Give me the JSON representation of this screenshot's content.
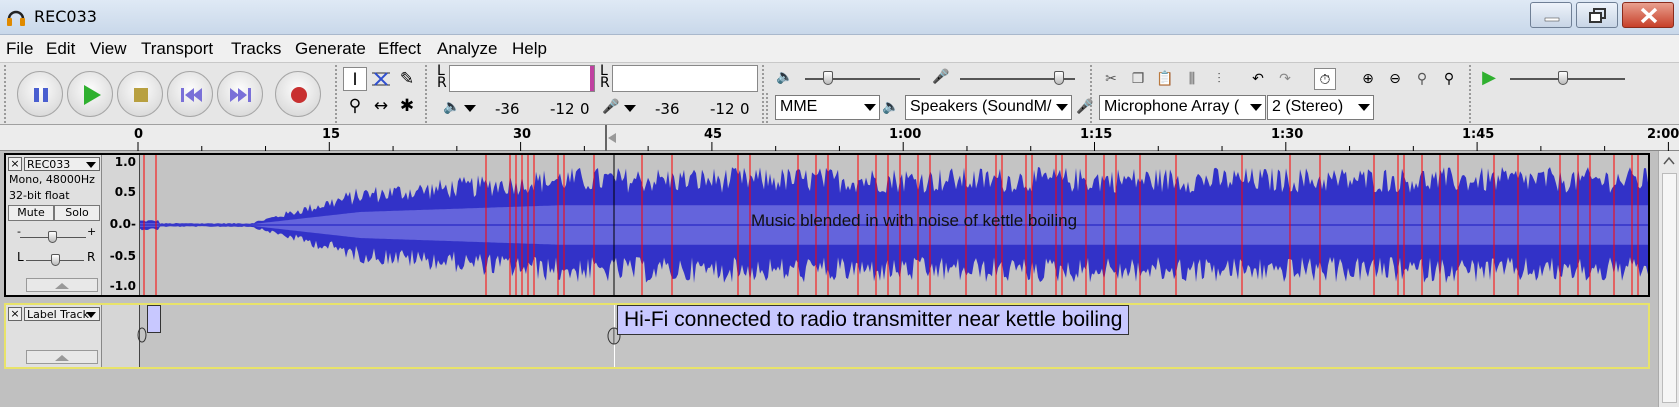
{
  "window": {
    "title": "REC033"
  },
  "menu": [
    "File",
    "Edit",
    "View",
    "Transport",
    "Tracks",
    "Generate",
    "Effect",
    "Analyze",
    "Help"
  ],
  "meters": {
    "play_ticks": [
      "-36",
      "-12",
      "0"
    ],
    "rec_ticks": [
      "-36",
      "-12",
      "0"
    ],
    "lr": [
      "L",
      "R"
    ]
  },
  "device": {
    "host": "MME",
    "output": "Speakers (SoundM/",
    "input": "Microphone Array (",
    "channels": "2 (Stereo)"
  },
  "ruler": {
    "ticks": [
      "0",
      "15",
      "30",
      "45",
      "1:00",
      "1:15",
      "1:30",
      "1:45",
      "2:00"
    ]
  },
  "audio_track": {
    "name": "REC033",
    "info1": "Mono, 48000Hz",
    "info2": "32-bit float",
    "mute": "Mute",
    "solo": "Solo",
    "gain_minus": "-",
    "gain_plus": "+",
    "pan_l": "L",
    "pan_r": "R",
    "scale": [
      "1.0",
      "0.5",
      "0.0-",
      "-0.5",
      "-1.0"
    ],
    "annotation": "Music blended in with noise of kettle boiling"
  },
  "label_track": {
    "name": "Label Track",
    "label_text": "Hi-Fi connected to radio transmitter near kettle boiling"
  },
  "colors": {
    "waveform": "#3232c8",
    "waveform_rms": "#6464dc",
    "clip_marker": "#ff0000",
    "label_bg": "#c8c8ff"
  }
}
